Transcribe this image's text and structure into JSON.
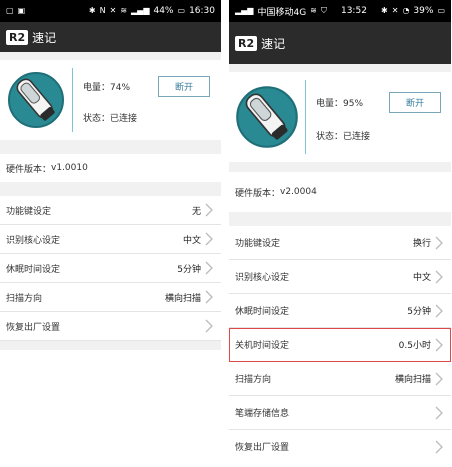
{
  "left": {
    "status": {
      "icons_left": [
        "message-icon",
        "image-icon"
      ],
      "icons_right": [
        "bluetooth-icon",
        "nfc-icon",
        "mute-icon",
        "wifi-icon",
        "signal-icon"
      ],
      "battery": "44%",
      "time": "16:30"
    },
    "app": {
      "logo": "R2",
      "title": "速记"
    },
    "device": {
      "battery_label": "电量：",
      "battery_value": "74%",
      "state_label": "状态：",
      "state_value": "已连接",
      "disconnect": "断开"
    },
    "firmware": {
      "label": "硬件版本：",
      "value": "v1.0010"
    },
    "settings": [
      {
        "label": "功能键设定",
        "value": "无"
      },
      {
        "label": "识别核心设定",
        "value": "中文"
      },
      {
        "label": "休眠时间设定",
        "value": "5分钟"
      },
      {
        "label": "扫描方向",
        "value": "横向扫描"
      },
      {
        "label": "恢复出厂设置",
        "value": ""
      }
    ]
  },
  "right": {
    "status": {
      "carrier": "中国移动4G",
      "time": "13:52",
      "battery": "39%"
    },
    "app": {
      "logo": "R2",
      "title": "速记"
    },
    "device": {
      "battery_label": "电量：",
      "battery_value": "95%",
      "state_label": "状态：",
      "state_value": "已连接",
      "disconnect": "断开"
    },
    "firmware": {
      "label": "硬件版本：",
      "value": "v2.0004"
    },
    "settings": [
      {
        "label": "功能键设定",
        "value": "换行"
      },
      {
        "label": "识别核心设定",
        "value": "中文"
      },
      {
        "label": "休眠时间设定",
        "value": "5分钟"
      },
      {
        "label": "关机时间设定",
        "value": "0.5小时",
        "highlighted": true
      },
      {
        "label": "扫描方向",
        "value": "横向扫描"
      },
      {
        "label": "笔端存储信息",
        "value": ""
      },
      {
        "label": "恢复出厂设置",
        "value": ""
      }
    ]
  },
  "colors": {
    "accent": "#3a7ea0",
    "divider": "#7dc3d6",
    "highlight": "#e04848",
    "appbar": "#2b2b2b"
  }
}
